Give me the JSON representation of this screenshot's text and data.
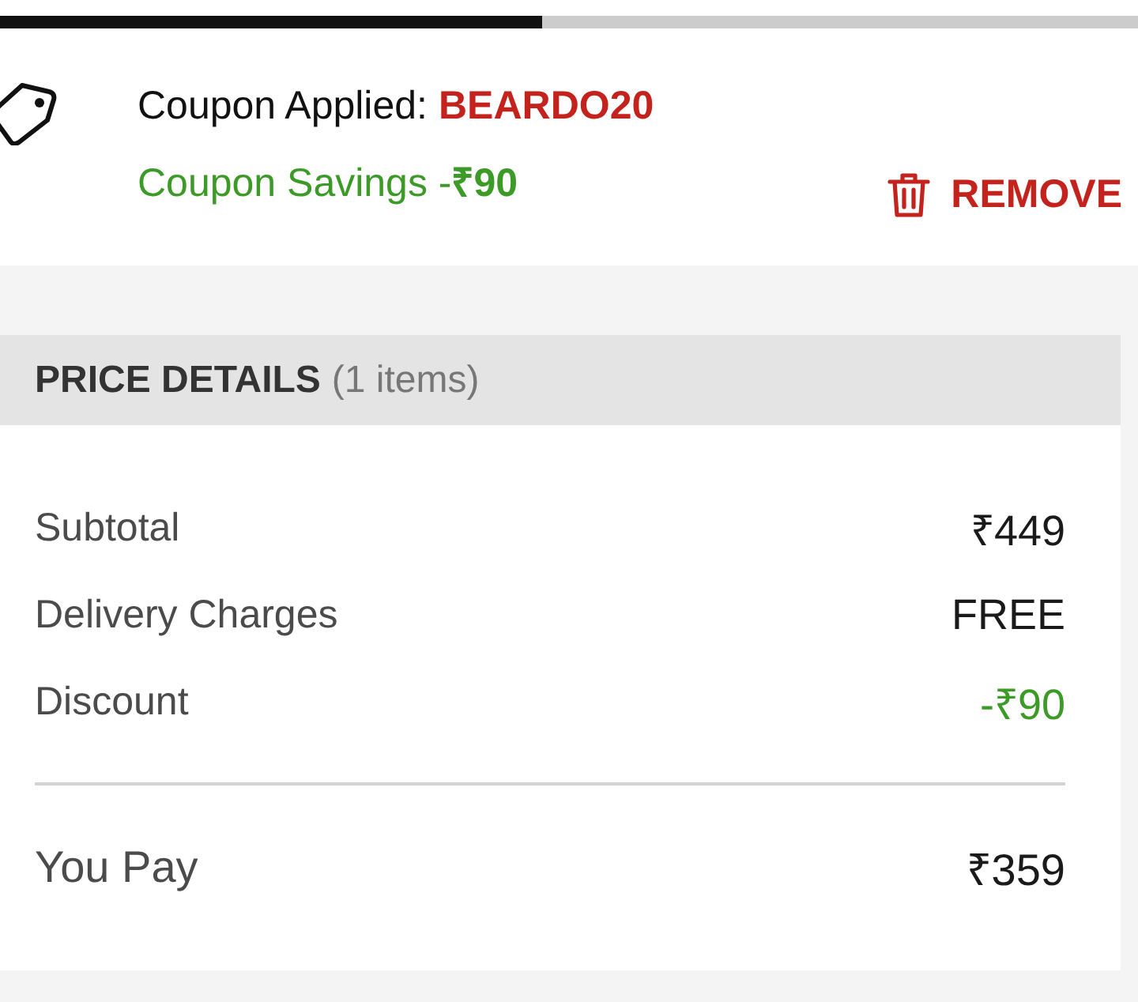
{
  "progress": {
    "level": 0.476
  },
  "coupon": {
    "label": "Coupon Applied:",
    "code": "BEARDO20",
    "savings": "Coupon Savings -**₹90**",
    "remove": "REMOVE"
  },
  "price_details": {
    "title": "PRICE DETAILS",
    "count": "(1 items)",
    "rows": [
      {
        "label": "Subtotal",
        "value": "₹449",
        "kind": "normal"
      },
      {
        "label": "Delivery Charges",
        "value": "FREE",
        "kind": "normal"
      },
      {
        "label": "Discount",
        "value": "-₹90",
        "kind": "discount"
      }
    ],
    "total": {
      "label": "You Pay",
      "value": "₹359"
    }
  }
}
